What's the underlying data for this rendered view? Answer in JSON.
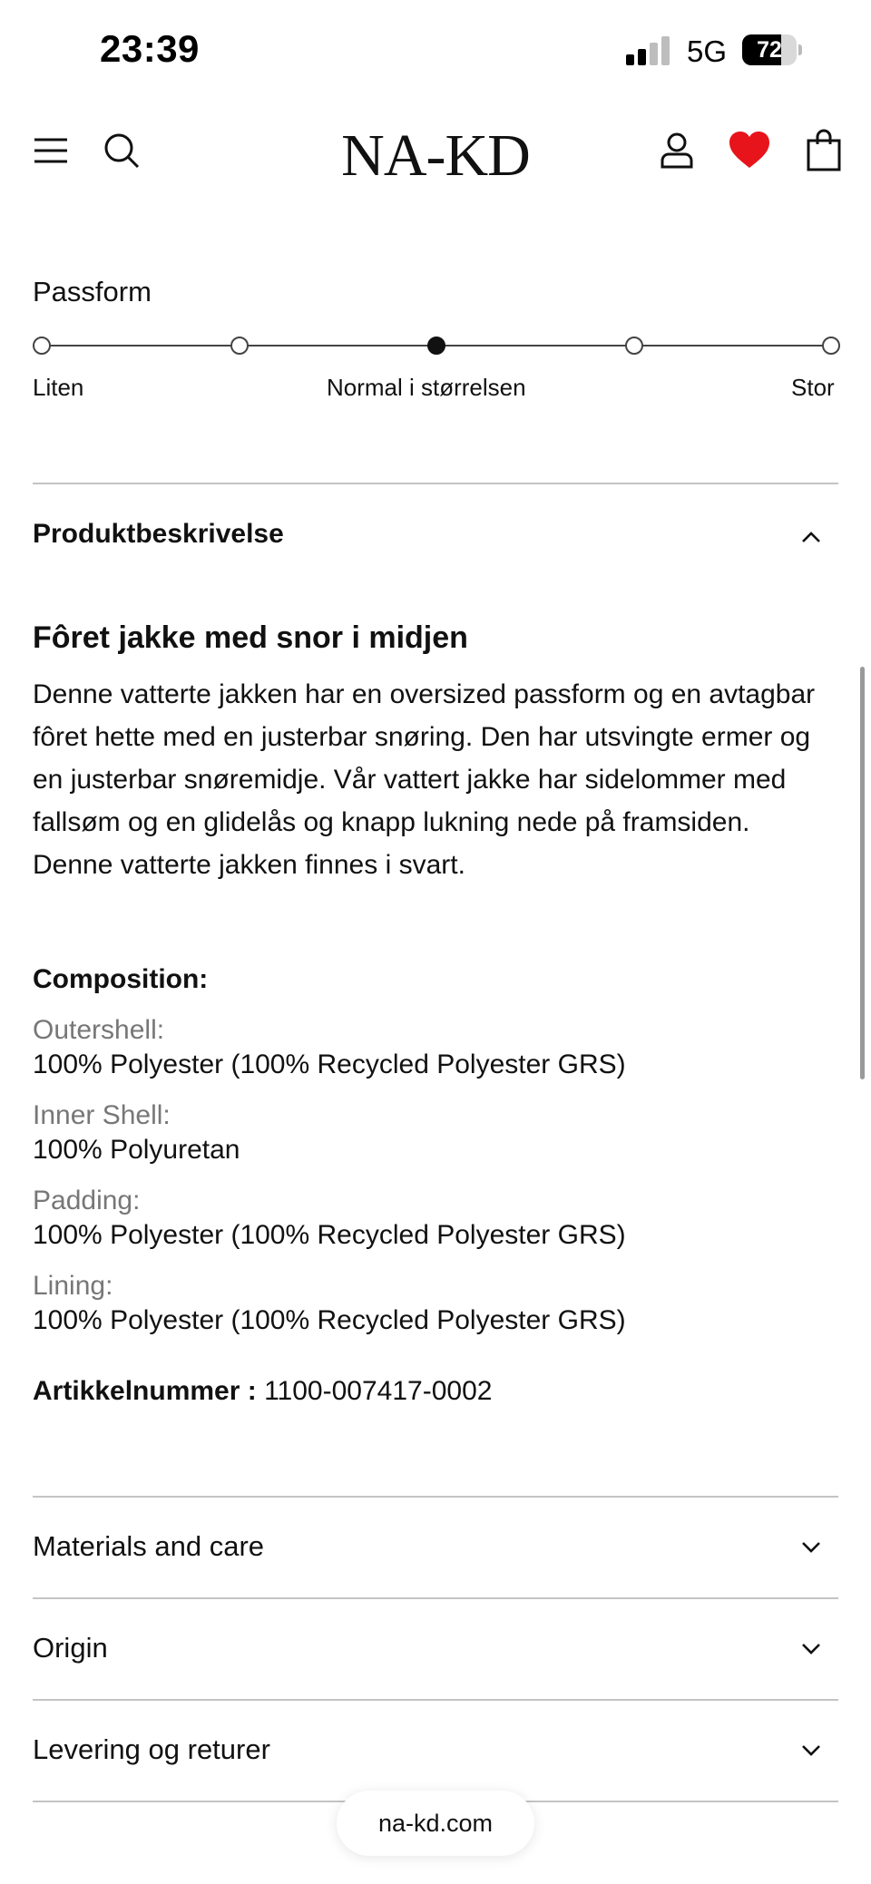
{
  "status": {
    "time": "23:39",
    "network": "5G",
    "battery": "72",
    "battery_level": 0.72
  },
  "header": {
    "logo": "NA-KD",
    "icons": {
      "menu": "menu-icon",
      "search": "search-icon",
      "account": "user-icon",
      "wishlist": "heart-icon",
      "cart": "shopping-bag-icon"
    },
    "wishlist_color": "#e8141b"
  },
  "fit": {
    "label": "Passform",
    "points": 5,
    "selected_index": 2,
    "captions": {
      "left": "Liten",
      "middle": "Normal i størrelsen",
      "right": "Stor"
    }
  },
  "description": {
    "section_title": "Produktbeskrivelse",
    "title": "Fôret jakke med snor i midjen",
    "text": "Denne vatterte jakken har en oversized passform og en avtagbar fôret hette med en justerbar snøring. Den har utsvingte ermer og en justerbar snøremidje. Vår vattert jakke har sidelommer med fallsøm og en glidelås og knapp lukning nede på framsiden. Denne vatterte jakken finnes i svart.",
    "composition_heading": "Composition:",
    "composition": [
      {
        "part": "Outershell:",
        "material": "100% Polyester (100% Recycled Polyester GRS)"
      },
      {
        "part": "Inner Shell:",
        "material": "100% Polyuretan"
      },
      {
        "part": "Padding:",
        "material": "100% Polyester (100% Recycled Polyester GRS)"
      },
      {
        "part": "Lining:",
        "material": "100% Polyester (100% Recycled Polyester GRS)"
      }
    ],
    "article_label": "Artikkelnummer :",
    "article_number": "1100-007417-0002"
  },
  "accordions": [
    {
      "label": "Materials and care"
    },
    {
      "label": "Origin"
    },
    {
      "label": "Levering og returer"
    }
  ],
  "browser": {
    "url": "na-kd.com"
  }
}
